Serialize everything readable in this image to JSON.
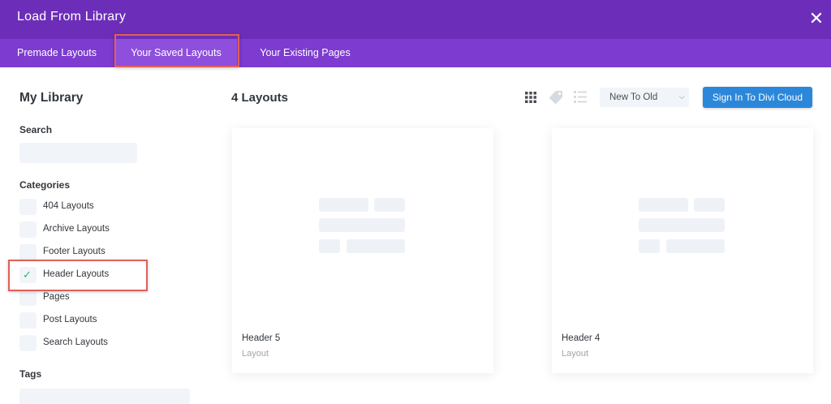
{
  "modal": {
    "title": "Load From Library",
    "close_glyph": "✕",
    "colors": {
      "header": "#6c2eb9",
      "tabbar": "#7d3bcf",
      "highlight": "#e0605a",
      "accent_button": "#2b87da",
      "check": "#2cb57a"
    }
  },
  "tabs": [
    {
      "label": "Premade Layouts"
    },
    {
      "label": "Your Saved Layouts",
      "active": true
    },
    {
      "label": "Your Existing Pages"
    }
  ],
  "sidebar": {
    "title": "My Library",
    "search_label": "Search",
    "search_placeholder": "",
    "categories_label": "Categories",
    "categories": [
      {
        "label": "404 Layouts",
        "checked": false
      },
      {
        "label": "Archive Layouts",
        "checked": false
      },
      {
        "label": "Footer Layouts",
        "checked": false
      },
      {
        "label": "Header Layouts",
        "checked": true
      },
      {
        "label": "Pages",
        "checked": false
      },
      {
        "label": "Post Layouts",
        "checked": false
      },
      {
        "label": "Search Layouts",
        "checked": false
      }
    ],
    "tags_label": "Tags"
  },
  "main": {
    "count_title": "4 Layouts",
    "view_icons": [
      "grid-icon",
      "tag-icon",
      "list-icon"
    ],
    "sort": {
      "selected": "New To Old"
    },
    "cloud_button": "Sign In To Divi Cloud",
    "cards": [
      {
        "name": "Header 5",
        "type": "Layout"
      },
      {
        "name": "Header 4",
        "type": "Layout"
      }
    ]
  }
}
